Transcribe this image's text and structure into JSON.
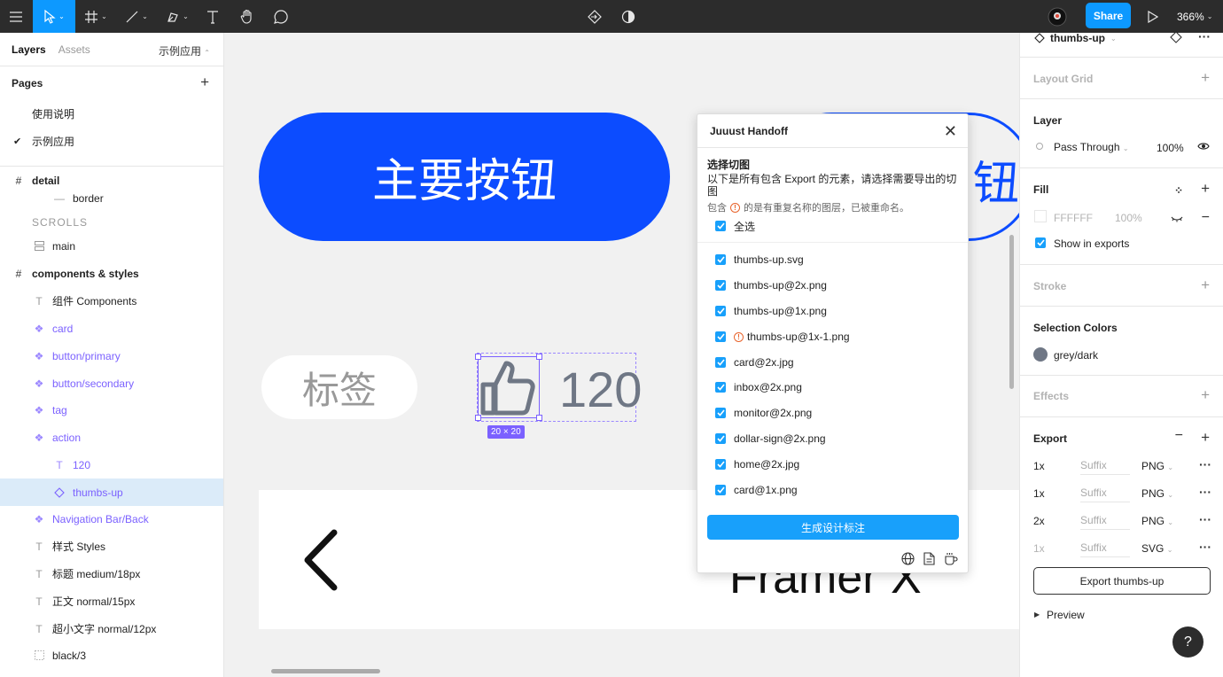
{
  "toolbar": {
    "zoom": "366%",
    "share_label": "Share"
  },
  "left_panel": {
    "tab_layers": "Layers",
    "tab_assets": "Assets",
    "current_page": "示例应用",
    "pages_title": "Pages",
    "pages": [
      {
        "label": "使用说明",
        "checked": false
      },
      {
        "label": "示例应用",
        "checked": true
      }
    ],
    "layers": [
      {
        "label": "detail",
        "icon": "frame-icon",
        "bold": true
      },
      {
        "label": "border",
        "icon": "line-icon"
      },
      {
        "label": "SCROLLS",
        "icon": "none"
      },
      {
        "label": "main",
        "icon": "autolayout-icon"
      },
      {
        "label": "components & styles",
        "icon": "frame-icon",
        "bold": true
      },
      {
        "label": "组件 Components",
        "icon": "text-icon"
      },
      {
        "label": "card",
        "icon": "component-icon"
      },
      {
        "label": "button/primary",
        "icon": "component-icon"
      },
      {
        "label": "button/secondary",
        "icon": "component-icon"
      },
      {
        "label": "tag",
        "icon": "component-icon"
      },
      {
        "label": "action",
        "icon": "component-icon"
      },
      {
        "label": "120",
        "icon": "text-icon"
      },
      {
        "label": "thumbs-up",
        "icon": "instance-icon"
      },
      {
        "label": "Navigation Bar/Back",
        "icon": "component-icon"
      },
      {
        "label": "样式 Styles",
        "icon": "text-icon"
      },
      {
        "label": "标题 medium/18px",
        "icon": "text-icon"
      },
      {
        "label": "正文 normal/15px",
        "icon": "text-icon"
      },
      {
        "label": "超小文字 normal/12px",
        "icon": "text-icon"
      },
      {
        "label": "black/3",
        "icon": "dotted-frame-icon"
      }
    ]
  },
  "canvas": {
    "primary_button_text": "主要按钮",
    "secondary_button_text": "钮",
    "tag_text": "标签",
    "count_text": "120",
    "size_badge": "20 × 20",
    "framer_text": "Framer X",
    "colors": {
      "primary": "#0c4cff",
      "selection": "#7b61ff",
      "canvas_bg": "#f1f1f1"
    }
  },
  "plugin": {
    "title": "Juuust Handoff",
    "section_title": "选择切图",
    "description": "以下是所有包含 Export 的元素，请选择需要导出的切图",
    "note_prefix": "包含",
    "note_suffix": "的是有重复名称的图层，已被重命名。",
    "select_all": "全选",
    "files": [
      {
        "name": "thumbs-up.svg",
        "warn": false
      },
      {
        "name": "thumbs-up@2x.png",
        "warn": false
      },
      {
        "name": "thumbs-up@1x.png",
        "warn": false
      },
      {
        "name": "thumbs-up@1x-1.png",
        "warn": true
      },
      {
        "name": "card@2x.jpg",
        "warn": false
      },
      {
        "name": "inbox@2x.png",
        "warn": false
      },
      {
        "name": "monitor@2x.png",
        "warn": false
      },
      {
        "name": "dollar-sign@2x.png",
        "warn": false
      },
      {
        "name": "home@2x.jpg",
        "warn": false
      },
      {
        "name": "card@1x.png",
        "warn": false
      }
    ],
    "generate_button": "生成设计标注",
    "accent": "#18a0fb"
  },
  "right_panel": {
    "selected_name": "thumbs-up",
    "layout_grid": "Layout Grid",
    "layer_title": "Layer",
    "blend_mode": "Pass Through",
    "layer_opacity": "100%",
    "fill_title": "Fill",
    "fill_hex": "FFFFFF",
    "fill_opacity": "100%",
    "show_in_exports": "Show in exports",
    "stroke_title": "Stroke",
    "selection_colors_title": "Selection Colors",
    "selection_color_name": "grey/dark",
    "selection_color_hex": "#6f7785",
    "effects_title": "Effects",
    "export_title": "Export",
    "exports": [
      {
        "scale": "1x",
        "suffix": "Suffix",
        "format": "PNG",
        "dim": false
      },
      {
        "scale": "1x",
        "suffix": "Suffix",
        "format": "PNG",
        "dim": false
      },
      {
        "scale": "2x",
        "suffix": "Suffix",
        "format": "PNG",
        "dim": false
      },
      {
        "scale": "1x",
        "suffix": "Suffix",
        "format": "SVG",
        "dim": true
      }
    ],
    "export_button": "Export thumbs-up",
    "preview": "Preview"
  },
  "help_label": "?"
}
